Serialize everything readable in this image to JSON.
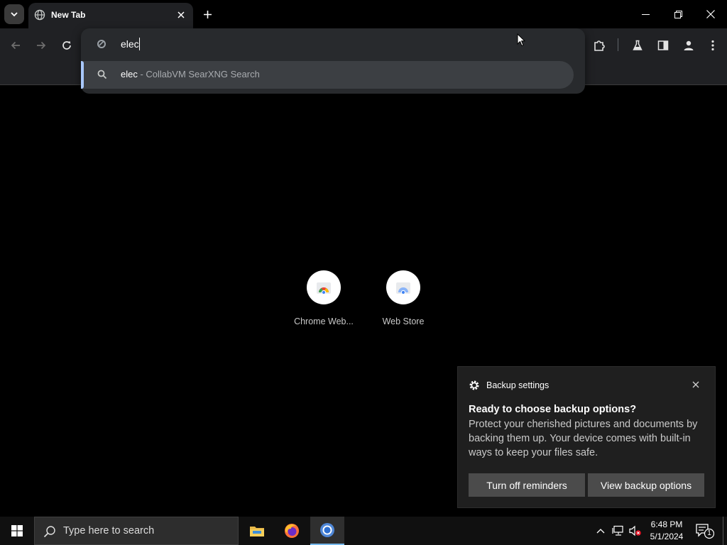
{
  "tab": {
    "title": "New Tab"
  },
  "omnibox": {
    "typed": "elec"
  },
  "suggestion": {
    "query": "elec",
    "description": " - CollabVM SearXNG Search"
  },
  "shortcuts": [
    {
      "label": "Chrome Web..."
    },
    {
      "label": "Web Store"
    }
  ],
  "toast": {
    "app_name": "Backup settings",
    "title": "Ready to choose backup options?",
    "body": "Protect your cherished pictures and documents by backing them up. Your device comes with built-in ways to keep your files safe.",
    "buttons": {
      "turn_off": "Turn off reminders",
      "view": "View backup options"
    }
  },
  "taskbar": {
    "search_placeholder": "Type here to search",
    "time": "6:48 PM",
    "date": "5/1/2024",
    "notification_count": "1"
  },
  "colors": {
    "accent": "#a8c7fa",
    "taskbar_active": "#76b9ed"
  }
}
